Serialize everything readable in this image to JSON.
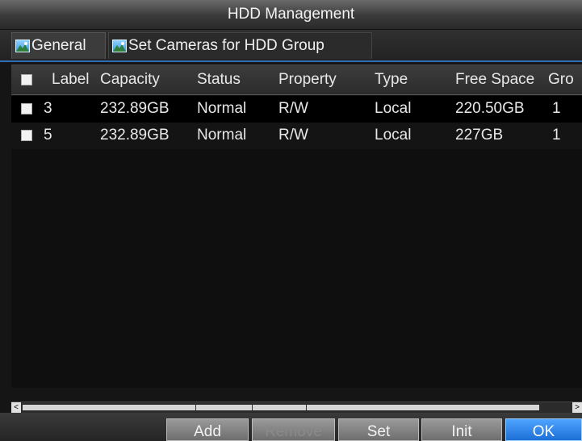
{
  "window": {
    "title": "HDD Management"
  },
  "tabs": [
    {
      "label": "General"
    },
    {
      "label": "Set Cameras for HDD Group"
    }
  ],
  "table": {
    "columns": [
      "Label",
      "Capacity",
      "Status",
      "Property",
      "Type",
      "Free Space",
      "Gro"
    ],
    "rows": [
      {
        "label": "3",
        "capacity": "232.89GB",
        "status": "Normal",
        "property": "R/W",
        "type": "Local",
        "free_space": "220.50GB",
        "group": "1"
      },
      {
        "label": "5",
        "capacity": "232.89GB",
        "status": "Normal",
        "property": "R/W",
        "type": "Local",
        "free_space": "227GB",
        "group": "1"
      }
    ]
  },
  "scrollbar": {
    "left_arrow": "<",
    "right_arrow": ">"
  },
  "buttons": {
    "add": "Add",
    "remove": "Remove",
    "set": "Set",
    "init": "Init",
    "ok": "OK"
  },
  "colors": {
    "selected_row": "#000000",
    "ok_button": "#2f86ea",
    "tab_underline": "#2f6db5"
  }
}
